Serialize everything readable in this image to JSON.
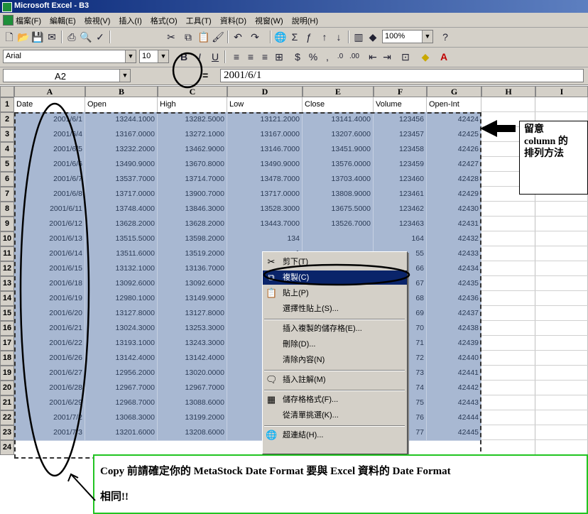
{
  "window": {
    "title": "Microsoft Excel - B3"
  },
  "menu": [
    "檔案(F)",
    "編輯(E)",
    "檢視(V)",
    "插入(I)",
    "格式(O)",
    "工具(T)",
    "資料(D)",
    "視窗(W)",
    "說明(H)"
  ],
  "toolbar": {
    "zoom": "100%",
    "font_name": "Arial",
    "font_size": "10",
    "icons": [
      "new-icon",
      "open-icon",
      "save-icon",
      "mail-icon",
      "print-icon",
      "preview-icon",
      "spell-icon",
      "cut-icon",
      "copy-icon",
      "paste-icon",
      "format-painter-icon",
      "undo-icon",
      "redo-icon",
      "hyperlink-icon",
      "autosum-icon",
      "function-icon",
      "sort-asc-icon",
      "sort-desc-icon",
      "chart-icon",
      "drawing-icon",
      "help-icon"
    ]
  },
  "formula_bar": {
    "name_box": "A2",
    "fx": "=",
    "value": "2001/6/1"
  },
  "sheet": {
    "columns": [
      "A",
      "B",
      "C",
      "D",
      "E",
      "F",
      "G",
      "H",
      "I"
    ],
    "header_row": [
      "Date",
      "Open",
      "High",
      "Low",
      "Close",
      "Volume",
      "Open-Int"
    ],
    "rows": [
      [
        "2001/6/1",
        "13244.1000",
        "13282.5000",
        "13121.2000",
        "13141.4000",
        "123456",
        "42424"
      ],
      [
        "2001/6/4",
        "13167.0000",
        "13272.1000",
        "13167.0000",
        "13207.6000",
        "123457",
        "42425"
      ],
      [
        "2001/6/5",
        "13232.2000",
        "13462.9000",
        "13146.7000",
        "13451.9000",
        "123458",
        "42426"
      ],
      [
        "2001/6/6",
        "13490.9000",
        "13670.8000",
        "13490.9000",
        "13576.0000",
        "123459",
        "42427"
      ],
      [
        "2001/6/7",
        "13537.7000",
        "13714.7000",
        "13478.7000",
        "13703.4000",
        "123460",
        "42428"
      ],
      [
        "2001/6/8",
        "13717.0000",
        "13900.7000",
        "13717.0000",
        "13808.9000",
        "123461",
        "42429"
      ],
      [
        "2001/6/11",
        "13748.4000",
        "13846.3000",
        "13528.3000",
        "13675.5000",
        "123462",
        "42430"
      ],
      [
        "2001/6/12",
        "13628.2000",
        "13628.2000",
        "13443.7000",
        "13526.7000",
        "123463",
        "42431"
      ],
      [
        "2001/6/13",
        "13515.5000",
        "13598.2000",
        "134",
        "",
        "164",
        "42432"
      ],
      [
        "2001/6/14",
        "13511.6000",
        "13519.2000",
        "1",
        "",
        "55",
        "42433"
      ],
      [
        "2001/6/15",
        "13132.1000",
        "13136.7000",
        "129",
        "",
        "66",
        "42434"
      ],
      [
        "2001/6/18",
        "13092.6000",
        "13092.6000",
        "128",
        "",
        "67",
        "42435"
      ],
      [
        "2001/6/19",
        "12980.1000",
        "13149.9000",
        "129",
        "",
        "68",
        "42436"
      ],
      [
        "2001/6/20",
        "13127.8000",
        "13127.8000",
        "128",
        "",
        "69",
        "42437"
      ],
      [
        "2001/6/21",
        "13024.3000",
        "13253.3000",
        "129",
        "",
        "70",
        "42438"
      ],
      [
        "2001/6/22",
        "13193.1000",
        "13243.3000",
        "131",
        "",
        "71",
        "42439"
      ],
      [
        "2001/6/26",
        "13142.4000",
        "13142.4000",
        "129",
        "",
        "72",
        "42440"
      ],
      [
        "2001/6/27",
        "12956.2000",
        "13020.0000",
        "129",
        "",
        "73",
        "42441"
      ],
      [
        "2001/6/28",
        "12967.7000",
        "12967.7000",
        "127",
        "",
        "74",
        "42442"
      ],
      [
        "2001/6/29",
        "12968.7000",
        "13088.6000",
        "129",
        "",
        "75",
        "42443"
      ],
      [
        "2001/7/2",
        "13068.3000",
        "13199.2000",
        "130",
        "",
        "76",
        "42444"
      ],
      [
        "2001/7/3",
        "13201.6000",
        "13208.6000",
        "130",
        "",
        "77",
        "42445"
      ]
    ],
    "row_numbers": [
      "1",
      "2",
      "3",
      "4",
      "5",
      "6",
      "7",
      "8",
      "9",
      "10",
      "11",
      "12",
      "13",
      "14",
      "15",
      "16",
      "17",
      "18",
      "19",
      "20",
      "21",
      "22",
      "23",
      "24"
    ]
  },
  "context_menu": [
    {
      "label": "剪下(T)",
      "icon": "cut-icon",
      "selected": false
    },
    {
      "label": "複製(C)",
      "icon": "copy-icon",
      "selected": true
    },
    {
      "label": "貼上(P)",
      "icon": "paste-icon",
      "selected": false
    },
    {
      "label": "選擇性貼上(S)...",
      "icon": "",
      "selected": false
    },
    {
      "label": "插入複製的儲存格(E)...",
      "icon": "",
      "selected": false
    },
    {
      "label": "刪除(D)...",
      "icon": "",
      "selected": false
    },
    {
      "label": "清除內容(N)",
      "icon": "",
      "selected": false
    },
    {
      "label": "插入註解(M)",
      "icon": "comment-icon",
      "selected": false
    },
    {
      "label": "儲存格格式(F)...",
      "icon": "format-cells-icon",
      "selected": false
    },
    {
      "label": "從清單挑選(K)...",
      "icon": "",
      "selected": false
    },
    {
      "label": "超連結(H)...",
      "icon": "hyperlink-icon",
      "selected": false
    }
  ],
  "annotations": {
    "callout_lines": [
      "留意",
      "column 的",
      "排列方法"
    ],
    "note_line1": "Copy 前請確定你的 MetaStock Date Format 要與 Excel 資料的 Date Format",
    "note_line2": "相同!!"
  },
  "colors": {
    "selection": "#a8b8d2",
    "title": "#0b2a7a",
    "highlight": "#0a246a",
    "note_border": "#22c422"
  }
}
